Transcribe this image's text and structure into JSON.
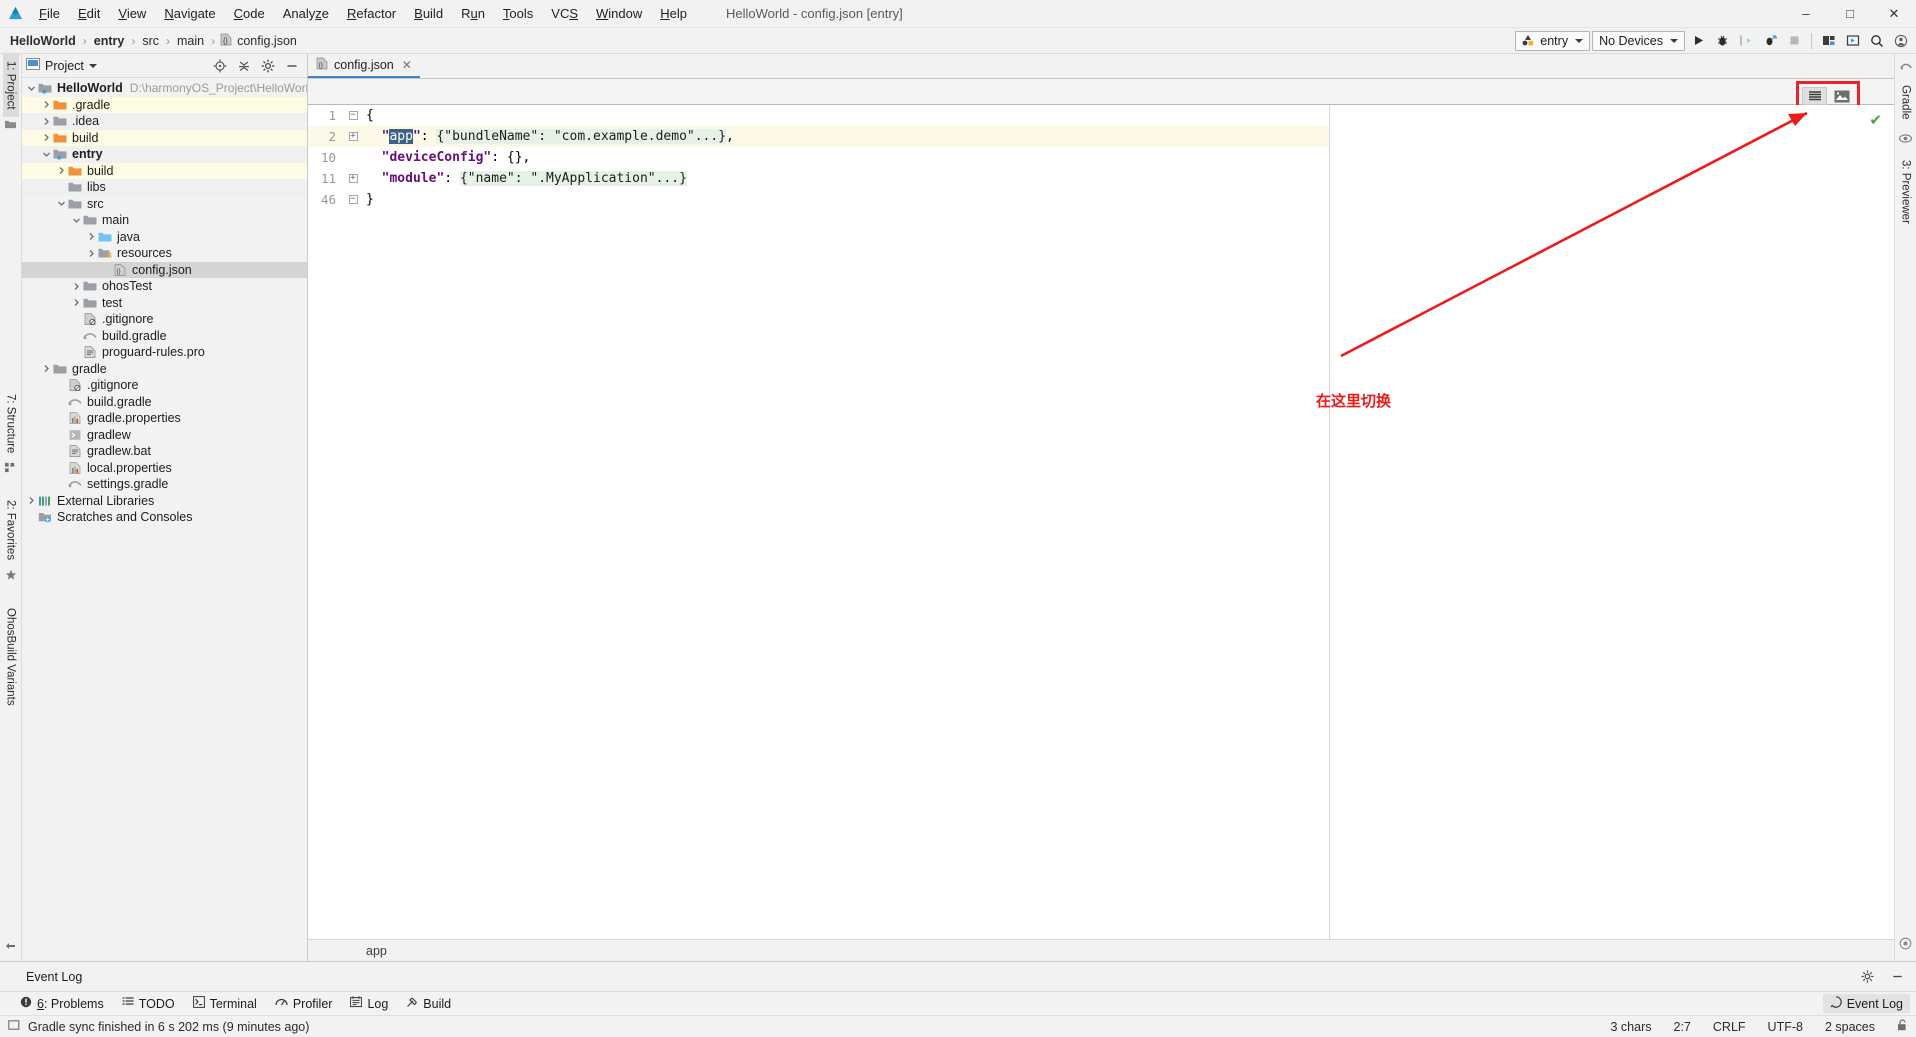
{
  "window": {
    "title": "HelloWorld - config.json [entry]",
    "minimize": "–",
    "maximize": "□",
    "close": "✕"
  },
  "menu": [
    {
      "label": "File"
    },
    {
      "label": "Edit"
    },
    {
      "label": "View"
    },
    {
      "label": "Navigate"
    },
    {
      "label": "Code"
    },
    {
      "label": "Analyze"
    },
    {
      "label": "Refactor"
    },
    {
      "label": "Build"
    },
    {
      "label": "Run"
    },
    {
      "label": "Tools"
    },
    {
      "label": "VCS"
    },
    {
      "label": "Window"
    },
    {
      "label": "Help"
    }
  ],
  "breadcrumb": {
    "items": [
      "HelloWorld",
      "entry",
      "src",
      "main",
      "config.json"
    ],
    "separator": "›"
  },
  "toolbar": {
    "module_selector": "entry",
    "device_selector": "No Devices",
    "run_icon": "run-triangle-icon",
    "debug_icon": "debug-bug-icon",
    "attach_icon": "attach-debugger-icon",
    "profile_icon": "profiler-icon",
    "stop_icon": "stop-icon",
    "project_structure_icon": "project-structure-icon",
    "device_manager_icon": "device-manager-icon",
    "search_icon": "search-everywhere-icon",
    "account_icon": "account-icon"
  },
  "project_panel": {
    "title": "Project",
    "locate_icon": "locate-file-icon",
    "collapse_icon": "collapse-all-icon",
    "settings_icon": "gear-icon",
    "hide_icon": "hide-panel-icon",
    "tree": [
      {
        "label": "HelloWorld",
        "path": "D:\\harmonyOS_Project\\HelloWorld",
        "depth": 0,
        "arrow": "down",
        "icon": "module-folder-icon",
        "bold": true,
        "state": "normal"
      },
      {
        "label": ".gradle",
        "depth": 1,
        "arrow": "right",
        "icon": "excluded-folder-icon",
        "state": "hl"
      },
      {
        "label": ".idea",
        "depth": 1,
        "arrow": "right",
        "icon": "folder-icon",
        "state": "alt"
      },
      {
        "label": "build",
        "depth": 1,
        "arrow": "right",
        "icon": "excluded-folder-icon",
        "state": "hl"
      },
      {
        "label": "entry",
        "depth": 1,
        "arrow": "down",
        "icon": "module-folder-icon",
        "bold": true,
        "state": "alt"
      },
      {
        "label": "build",
        "depth": 2,
        "arrow": "right",
        "icon": "excluded-folder-icon",
        "state": "hl"
      },
      {
        "label": "libs",
        "depth": 2,
        "arrow": "none",
        "icon": "folder-icon",
        "state": "alt"
      },
      {
        "label": "src",
        "depth": 2,
        "arrow": "down",
        "icon": "folder-icon",
        "state": "normal"
      },
      {
        "label": "main",
        "depth": 3,
        "arrow": "down",
        "icon": "folder-icon",
        "state": "normal"
      },
      {
        "label": "java",
        "depth": 4,
        "arrow": "right",
        "icon": "source-folder-icon",
        "state": "normal"
      },
      {
        "label": "resources",
        "depth": 4,
        "arrow": "right",
        "icon": "resource-folder-icon",
        "state": "normal"
      },
      {
        "label": "config.json",
        "depth": 5,
        "arrow": "none",
        "icon": "json-file-icon",
        "state": "sel"
      },
      {
        "label": "ohosTest",
        "depth": 3,
        "arrow": "right",
        "icon": "folder-icon",
        "state": "normal"
      },
      {
        "label": "test",
        "depth": 3,
        "arrow": "right",
        "icon": "folder-icon",
        "state": "normal"
      },
      {
        "label": ".gitignore",
        "depth": 3,
        "arrow": "none",
        "icon": "gitignore-file-icon",
        "state": "normal"
      },
      {
        "label": "build.gradle",
        "depth": 3,
        "arrow": "none",
        "icon": "gradle-file-icon",
        "state": "normal"
      },
      {
        "label": "proguard-rules.pro",
        "depth": 3,
        "arrow": "none",
        "icon": "text-file-icon",
        "state": "normal"
      },
      {
        "label": "gradle",
        "depth": 1,
        "arrow": "right",
        "icon": "folder-icon",
        "state": "normal"
      },
      {
        "label": ".gitignore",
        "depth": 2,
        "arrow": "none",
        "icon": "gitignore-file-icon",
        "state": "normal"
      },
      {
        "label": "build.gradle",
        "depth": 2,
        "arrow": "none",
        "icon": "gradle-file-icon",
        "state": "normal"
      },
      {
        "label": "gradle.properties",
        "depth": 2,
        "arrow": "none",
        "icon": "properties-file-icon",
        "state": "normal"
      },
      {
        "label": "gradlew",
        "depth": 2,
        "arrow": "none",
        "icon": "script-file-icon",
        "state": "normal"
      },
      {
        "label": "gradlew.bat",
        "depth": 2,
        "arrow": "none",
        "icon": "text-file-icon",
        "state": "normal"
      },
      {
        "label": "local.properties",
        "depth": 2,
        "arrow": "none",
        "icon": "properties-file-icon",
        "state": "normal"
      },
      {
        "label": "settings.gradle",
        "depth": 2,
        "arrow": "none",
        "icon": "gradle-file-icon",
        "state": "normal"
      },
      {
        "label": "External Libraries",
        "depth": 0,
        "arrow": "right",
        "icon": "libraries-icon",
        "state": "normal"
      },
      {
        "label": "Scratches and Consoles",
        "depth": 0,
        "arrow": "none",
        "icon": "scratches-icon",
        "state": "normal"
      }
    ]
  },
  "left_strip": {
    "project_tab": "1: Project",
    "structure_tab": "7: Structure",
    "favorites_tab": "2: Favorites",
    "ohos_tab": "OhosBuild Variants"
  },
  "right_strip": {
    "gradle_tab": "Gradle",
    "previewer_tab": "3: Previewer"
  },
  "editor": {
    "tab_label": "config.json",
    "tab_close": "✕",
    "view_text_icon": "text-view-icon",
    "view_preview_icon": "preview-image-icon",
    "inspection_ok_icon": "inspection-ok-check",
    "breadcrumb_bottom": "app",
    "lines": [
      {
        "num": "1",
        "fold": "minus",
        "current": false,
        "segments": [
          {
            "t": "{",
            "cls": "p"
          }
        ]
      },
      {
        "num": "2",
        "fold": "plus",
        "current": true,
        "segments": [
          {
            "t": "  ",
            "cls": "p"
          },
          {
            "t": "\"",
            "cls": "k"
          },
          {
            "t": "app",
            "cls": "selhl"
          },
          {
            "t": "\"",
            "cls": "k"
          },
          {
            "t": ": ",
            "cls": "p"
          },
          {
            "t": "{\"bundleName\": \"com.example.demo\"...}",
            "cls": "folded"
          },
          {
            "t": ",",
            "cls": "p"
          }
        ]
      },
      {
        "num": "10",
        "fold": "none",
        "current": false,
        "segments": [
          {
            "t": "  ",
            "cls": "p"
          },
          {
            "t": "\"deviceConfig\"",
            "cls": "k"
          },
          {
            "t": ": {},",
            "cls": "p"
          }
        ]
      },
      {
        "num": "11",
        "fold": "plus",
        "current": false,
        "segments": [
          {
            "t": "  ",
            "cls": "p"
          },
          {
            "t": "\"module\"",
            "cls": "k"
          },
          {
            "t": ": ",
            "cls": "p"
          },
          {
            "t": "{\"name\": \".MyApplication\"...}",
            "cls": "folded"
          }
        ]
      },
      {
        "num": "46",
        "fold": "minus",
        "current": false,
        "segments": [
          {
            "t": "}",
            "cls": "p"
          }
        ]
      }
    ]
  },
  "annotation": {
    "text": "在这里切换",
    "color": "#ee1b1b"
  },
  "event_log": {
    "title": "Event Log",
    "settings_icon": "gear-icon",
    "hide_icon": "hide-panel-icon"
  },
  "tool_windows": [
    {
      "label": "6: Problems",
      "icon": "problems-icon"
    },
    {
      "label": "TODO",
      "icon": "todo-icon"
    },
    {
      "label": "Terminal",
      "icon": "terminal-icon"
    },
    {
      "label": "Profiler",
      "icon": "profiler-icon"
    },
    {
      "label": "Log",
      "icon": "log-icon"
    },
    {
      "label": "Build",
      "icon": "build-hammer-icon"
    }
  ],
  "event_log_button": {
    "label": "Event Log",
    "icon": "event-log-icon"
  },
  "status_bar": {
    "message": "Gradle sync finished in 6 s 202 ms (9 minutes ago)",
    "message_icon": "status-square-icon",
    "chars": "3 chars",
    "caret": "2:7",
    "line_sep": "CRLF",
    "encoding": "UTF-8",
    "indent": "2 spaces",
    "lock_icon": "unlocked-padlock-icon"
  },
  "colors": {
    "accent_blue": "#4083c9",
    "annotation_red": "#ee1b1b",
    "folded_bg": "#e6f2e6",
    "selection_blue": "#3d6185",
    "current_line": "#fdf9e8",
    "highlight_yellow": "#fdfbe3"
  }
}
